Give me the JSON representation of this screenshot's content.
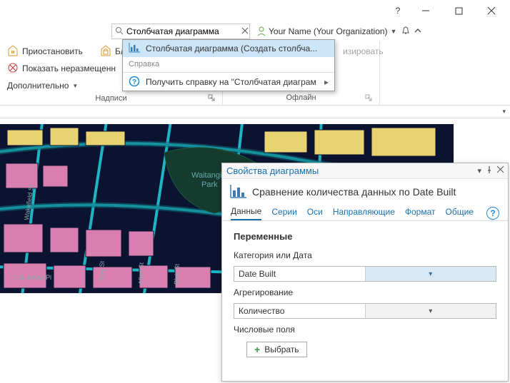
{
  "titlebar": {},
  "search": {
    "value": "Столбчатая диаграмма"
  },
  "user": {
    "label": "Your Name (Your Organization)"
  },
  "ribbon": {
    "group1": {
      "pause": "Приостановить",
      "lock": "Бло",
      "unplaced": "Показать неразмещенн",
      "more": "Дополнительно",
      "label": "Надписи"
    },
    "group2": {
      "sync_fragment": "изировать",
      "label": "Офлайн"
    }
  },
  "dropdown": {
    "item1": "Столбчатая диаграмма (Создать столбча...",
    "heading": "Справка",
    "item2": "Получить справку на \"Столбчатая диаграм"
  },
  "pane": {
    "title": "Свойства диаграммы",
    "subtitle": "Сравнение количества данных по Date Built",
    "tabs": {
      "data": "Данные",
      "series": "Серии",
      "axes": "Оси",
      "guides": "Направляющие",
      "format": "Формат",
      "general": "Общие"
    },
    "body": {
      "section": "Переменные",
      "category_label": "Категория или Дата",
      "category_value": "Date Built",
      "agg_label": "Агрегирование",
      "agg_value": "Количество",
      "numfields_label": "Числовые поля",
      "choose": "Выбрать"
    }
  }
}
